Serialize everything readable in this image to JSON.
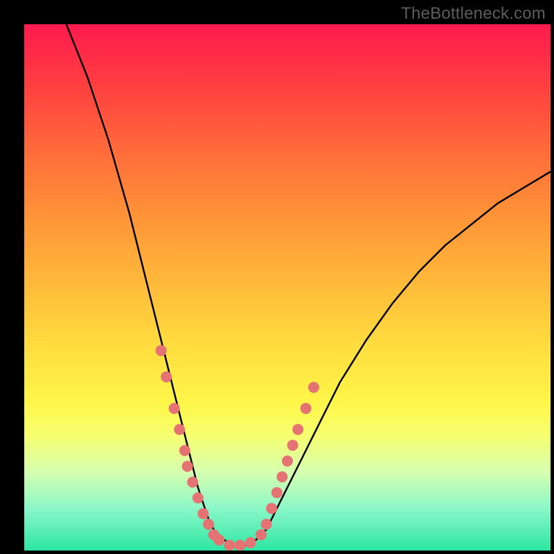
{
  "watermark": "TheBottleneck.com",
  "chart_data": {
    "type": "line",
    "title": "",
    "xlabel": "",
    "ylabel": "",
    "xlim": [
      0,
      100
    ],
    "ylim": [
      0,
      100
    ],
    "series": [
      {
        "name": "curve",
        "color": "#000000",
        "x": [
          8,
          12,
          16,
          20,
          23,
          25,
          27,
          29,
          30,
          32,
          33,
          34,
          35,
          36,
          37,
          38,
          40,
          42,
          44,
          46,
          48,
          52,
          56,
          60,
          65,
          70,
          75,
          80,
          85,
          90,
          95,
          100
        ],
        "y": [
          100,
          90,
          78,
          64,
          52,
          44,
          36,
          28,
          24,
          16,
          12,
          9,
          6,
          4,
          3,
          2,
          1,
          1,
          2,
          4,
          8,
          16,
          24,
          32,
          40,
          47,
          53,
          58,
          62,
          66,
          69,
          72
        ]
      }
    ],
    "markers": [
      {
        "name": "dots",
        "color": "#e57373",
        "radius": 8,
        "points": [
          {
            "x": 26,
            "y": 38
          },
          {
            "x": 27,
            "y": 33
          },
          {
            "x": 28.5,
            "y": 27
          },
          {
            "x": 29.5,
            "y": 23
          },
          {
            "x": 30.5,
            "y": 19
          },
          {
            "x": 31,
            "y": 16
          },
          {
            "x": 32,
            "y": 13
          },
          {
            "x": 33,
            "y": 10
          },
          {
            "x": 34,
            "y": 7
          },
          {
            "x": 35,
            "y": 5
          },
          {
            "x": 36,
            "y": 3
          },
          {
            "x": 37,
            "y": 2
          },
          {
            "x": 39,
            "y": 1
          },
          {
            "x": 41,
            "y": 1
          },
          {
            "x": 43,
            "y": 1.5
          },
          {
            "x": 45,
            "y": 3
          },
          {
            "x": 46,
            "y": 5
          },
          {
            "x": 47,
            "y": 8
          },
          {
            "x": 48,
            "y": 11
          },
          {
            "x": 49,
            "y": 14
          },
          {
            "x": 50,
            "y": 17
          },
          {
            "x": 51,
            "y": 20
          },
          {
            "x": 52,
            "y": 23
          },
          {
            "x": 53.5,
            "y": 27
          },
          {
            "x": 55,
            "y": 31
          }
        ]
      }
    ]
  }
}
